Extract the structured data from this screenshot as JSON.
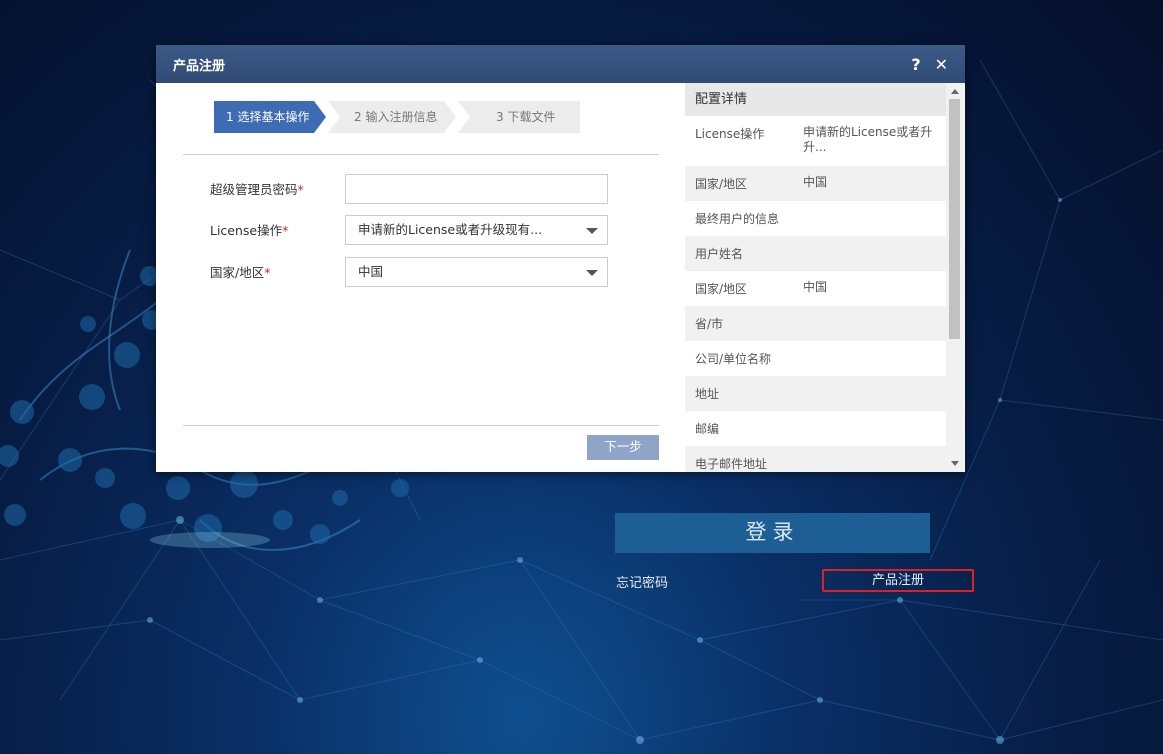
{
  "dialog": {
    "title": "产品注册",
    "help_label": "?",
    "close_label": "✕"
  },
  "steps": [
    "1 选择基本操作",
    "2 输入注册信息",
    "3 下载文件"
  ],
  "form": {
    "password_label": "超级管理员密码",
    "license_label": "License操作",
    "license_value": "申请新的License或者升级现有...",
    "country_label": "国家/地区",
    "country_value": "中国",
    "required_mark": "*",
    "next_label": "下一步"
  },
  "details": {
    "title": "配置详情",
    "rows": [
      {
        "key": "License操作",
        "value": "申请新的License或者升\n升..."
      },
      {
        "key": "国家/地区",
        "value": "中国"
      },
      {
        "key": "最终用户的信息",
        "value": ""
      },
      {
        "key": "用户姓名",
        "value": ""
      },
      {
        "key": "国家/地区",
        "value": "中国"
      },
      {
        "key": "省/市",
        "value": ""
      },
      {
        "key": "公司/单位名称",
        "value": ""
      },
      {
        "key": "地址",
        "value": ""
      },
      {
        "key": "邮编",
        "value": ""
      },
      {
        "key": "电子邮件地址",
        "value": ""
      }
    ]
  },
  "login": {
    "login_label": "登录",
    "forgot_label": "忘记密码",
    "register_label": "产品注册"
  },
  "colors": {
    "header": "#2f4b76",
    "active_step": "#3d6cb5",
    "login_button": "#1d5f94",
    "highlight": "#e02020"
  }
}
